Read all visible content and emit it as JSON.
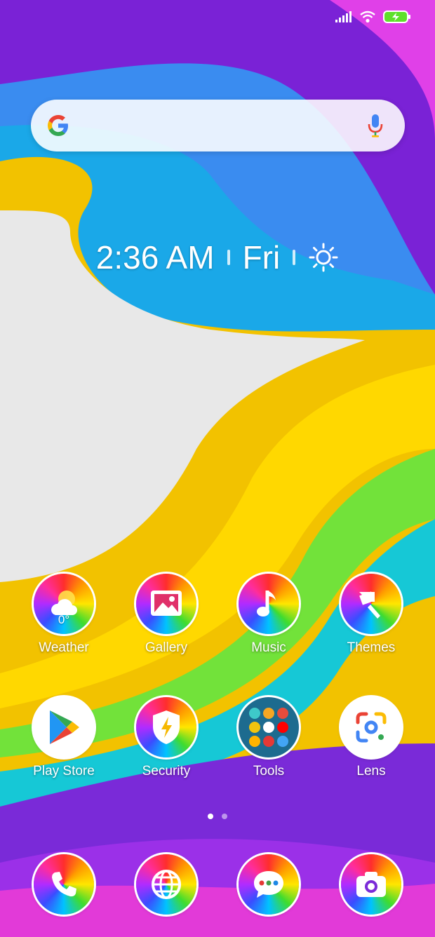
{
  "status_bar": {
    "signal_icon": "cellular-signal-icon",
    "wifi_icon": "wifi-icon",
    "battery_icon": "battery-charging-icon"
  },
  "search": {
    "logo_icon": "google-g-logo",
    "mic_icon": "mic-icon",
    "placeholder": ""
  },
  "clock": {
    "time": "2:36 AM",
    "day": "Fri",
    "weather_icon": "sun-icon"
  },
  "apps_row1": [
    {
      "label": "Weather",
      "icon": "weather-icon",
      "badge": "0°"
    },
    {
      "label": "Gallery",
      "icon": "gallery-icon"
    },
    {
      "label": "Music",
      "icon": "music-note-icon"
    },
    {
      "label": "Themes",
      "icon": "paint-brush-icon"
    }
  ],
  "apps_row2": [
    {
      "label": "Play Store",
      "icon": "play-store-icon"
    },
    {
      "label": "Security",
      "icon": "shield-bolt-icon"
    },
    {
      "label": "Tools",
      "icon": "folder-grid-icon"
    },
    {
      "label": "Lens",
      "icon": "lens-icon"
    }
  ],
  "page_indicator": {
    "pages": 2,
    "active": 1
  },
  "dock": [
    {
      "icon": "phone-icon"
    },
    {
      "icon": "browser-globe-icon"
    },
    {
      "icon": "messages-icon"
    },
    {
      "icon": "camera-icon"
    }
  ],
  "colors": {
    "purple": "#7b2bd8",
    "blue": "#1a8ef0",
    "yellow": "#ffd400",
    "green": "#5fe02a"
  }
}
